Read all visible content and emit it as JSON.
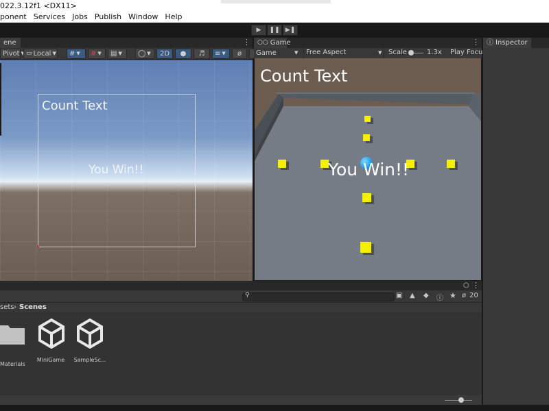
{
  "window": {
    "title": "022.3.12f1 <DX11>"
  },
  "menu": {
    "items": [
      "ponent",
      "Services",
      "Jobs",
      "Publish",
      "Window",
      "Help"
    ]
  },
  "toolbar": {
    "play_icon": "play-icon",
    "pause_icon": "pause-icon",
    "step_icon": "step-icon"
  },
  "scene": {
    "tab_label": "ene",
    "pivot_label": "Pivot",
    "local_label": "Local",
    "mode_2d_label": "2D",
    "count_text": "Count Text",
    "win_text": "You Win!!"
  },
  "game": {
    "tab_label": "Game",
    "display_label": "Game",
    "aspect_label": "Free Aspect",
    "scale_label": "Scale",
    "scale_value": "1.3x",
    "play_focus_label": "Play Focus",
    "count_text": "Count Text",
    "win_text": "You Win!!"
  },
  "inspector": {
    "tab_label": "Inspector"
  },
  "project": {
    "breadcrumb": [
      "sets",
      "Scenes"
    ],
    "hidden_count": "20",
    "assets": [
      {
        "label": "Materials",
        "icon": "folder-icon"
      },
      {
        "label": "MiniGame",
        "icon": "unity-scene-icon"
      },
      {
        "label": "SampleSc...",
        "icon": "unity-scene-icon"
      }
    ]
  },
  "colors": {
    "accent": "#3a5a80",
    "cube": "#f4f000",
    "player": "#1aa0e8"
  }
}
